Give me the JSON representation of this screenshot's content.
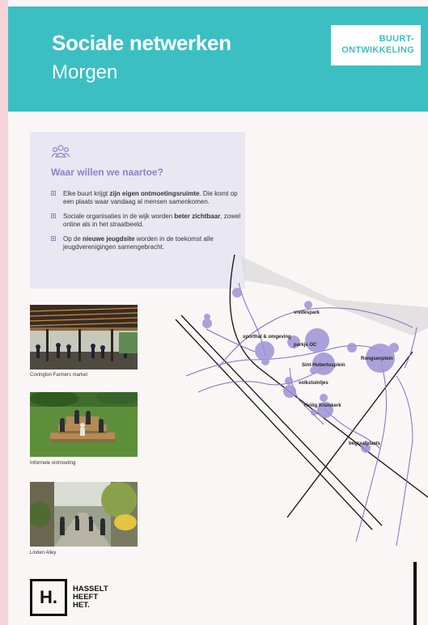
{
  "header": {
    "title": "Sociale netwerken",
    "subtitle": "Morgen",
    "tag_line1": "BUURT-",
    "tag_line2": "ONTWIKKELING"
  },
  "panel": {
    "icon": "people-group-icon",
    "heading": "Waar willen we naartoe?",
    "bullets": [
      {
        "pre": "Elke buurt krijgt ",
        "bold": "zijn eigen ontmoetingsruimte",
        "post": ". Die komt op een plaats waar vandaag al mensen samenkomen."
      },
      {
        "pre": "Sociale organisaties in de wijk worden ",
        "bold": "beter zichtbaar",
        "post": ", zowel online als in het straatbeeld."
      },
      {
        "pre": "Op de ",
        "bold": "nieuwe jeugdsite",
        "post": " worden in de toekomst alle jeugdverenigingen samengebracht."
      }
    ]
  },
  "photos": [
    {
      "caption": "Covington Farmers market"
    },
    {
      "caption": "Informele ontmoeting"
    },
    {
      "caption": "Linden Alley"
    }
  ],
  "map": {
    "labels": {
      "vredespark": "vredespark",
      "sporthal": "sporthal & omgeving",
      "parkje": "parkje OC",
      "hubertus": "Sint-Hubertusplein",
      "rongsen": "Rongsenplein",
      "volkstuintjes": "volkstuintjes",
      "heilig": "Heilig Kruiskerk",
      "begraafplaats": "begraafplaats"
    }
  },
  "logo": {
    "mark": "H.",
    "line1": "HASSELT",
    "line2": "HEEFT",
    "line3": "HET."
  },
  "colors": {
    "teal": "#3cbfc2",
    "purple": "#8e82c8",
    "panel": "#e9e7f2",
    "pink": "#f6d3d9"
  }
}
